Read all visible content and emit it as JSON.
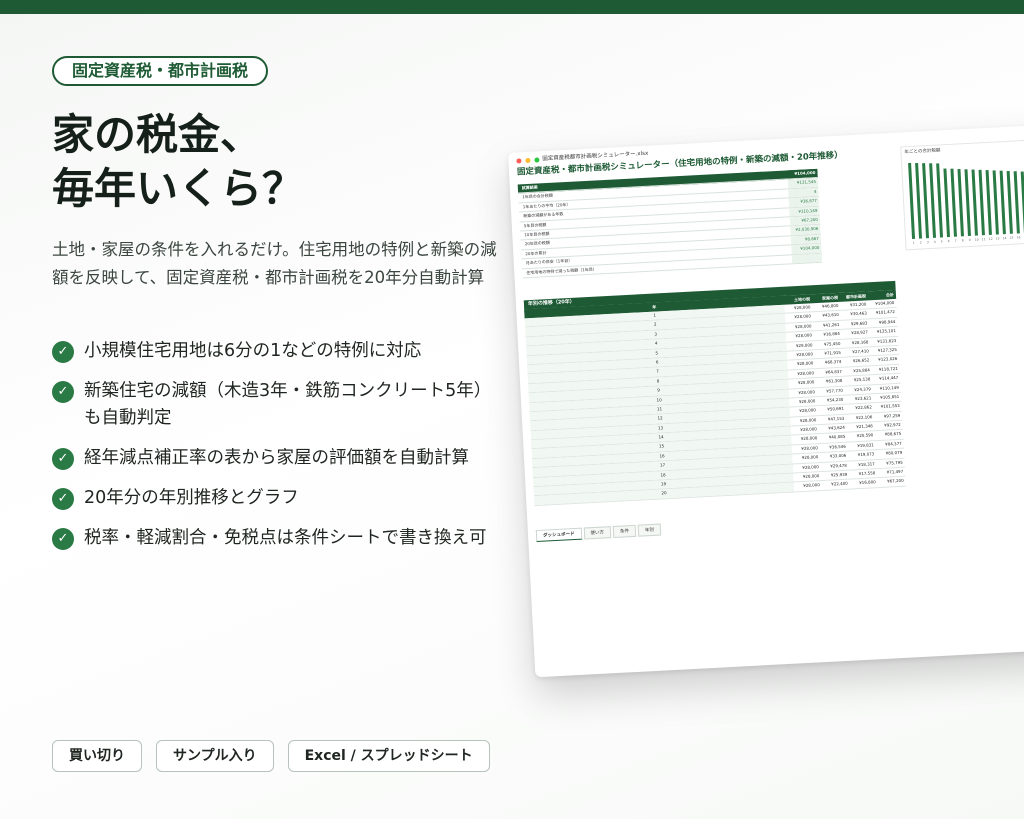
{
  "brand": {
    "primary": "#1e5b35",
    "accent": "#2a7a45"
  },
  "category": "固定資産税・都市計画税",
  "headline": {
    "line1": "家の税金、",
    "line2": "毎年いくら？"
  },
  "description": "土地・家屋の条件を入れるだけ。住宅用地の特例と新築の減額を反映して、固定資産税・都市計画税を20年分自動計算",
  "features": [
    "小規模住宅用地は6分の1などの特例に対応",
    "新築住宅の減額（木造3年・鉄筋コンクリート5年）も自動判定",
    "経年減点補正率の表から家屋の評価額を自動計算",
    "20年分の年別推移とグラフ",
    "税率・軽減割合・免税点は条件シートで書き換え可"
  ],
  "check_icon": "check-circle-icon",
  "chips": [
    "買い切り",
    "サンプル入り",
    "Excel / スプレッドシート"
  ],
  "spreadsheet": {
    "filename": "固定資産税都市計画税シミュレーター.xlsx",
    "title": "固定資産税・都市計画税シミュレーター（住宅用地の特例・新築の減額・20年推移）",
    "results_title": "試算結果",
    "results_title_value": "¥104,000",
    "results": [
      {
        "label": "1年目の合計税額",
        "value": "¥131,545"
      },
      {
        "label": "1年あたりの平均（20年）",
        "value": "4"
      },
      {
        "label": "新築の減額がある年数",
        "value": "¥36,877"
      },
      {
        "label": "5年目の税額",
        "value": "¥110,149"
      },
      {
        "label": "10年目の税額",
        "value": "¥67,200"
      },
      {
        "label": "20年目の税額",
        "value": "¥2,030,906"
      },
      {
        "label": "20年の累計",
        "value": "¥8,667"
      },
      {
        "label": "月あたりの目安（1年目）",
        "value": "¥104,000"
      },
      {
        "label": "住宅用地の特例で減った税額（1年目）",
        "value": ""
      }
    ],
    "chart_title": "年ごとの合計税額",
    "chart_values": [
      131545,
      130800,
      129900,
      129100,
      128200,
      118800,
      117800,
      116600,
      115500,
      114400,
      113300,
      112200,
      111000,
      109900,
      108800,
      107700,
      106600,
      105500,
      104400,
      104000
    ],
    "chart_ticks": [
      "1",
      "2",
      "3",
      "4",
      "5",
      "6",
      "7",
      "8",
      "9",
      "10",
      "11",
      "12",
      "13",
      "14",
      "15",
      "16",
      "17",
      "18",
      "19",
      "20"
    ],
    "annual_title": "年別の推移（20年）",
    "annual_columns": [
      "年",
      "土地の税",
      "家屋の税",
      "都市計画税",
      "合計"
    ],
    "annual_rows": [
      [
        "1",
        "¥28,000",
        "¥46,800",
        "¥31,200",
        "¥104,000"
      ],
      [
        "2",
        "¥28,000",
        "¥43,610",
        "¥30,463",
        "¥101,472"
      ],
      [
        "3",
        "¥28,000",
        "¥41,261",
        "¥29,683",
        "¥98,944"
      ],
      [
        "4",
        "¥28,000",
        "¥16,884",
        "¥28,927",
        "¥135,101"
      ],
      [
        "5",
        "¥28,000",
        "¥75,450",
        "¥28,168",
        "¥131,823"
      ],
      [
        "6",
        "¥28,000",
        "¥71,915",
        "¥27,410",
        "¥127,325"
      ],
      [
        "7",
        "¥28,000",
        "¥68,374",
        "¥26,652",
        "¥123,026"
      ],
      [
        "8",
        "¥28,000",
        "¥64,837",
        "¥25,884",
        "¥118,721"
      ],
      [
        "9",
        "¥28,000",
        "¥61,308",
        "¥25,138",
        "¥114,447"
      ],
      [
        "10",
        "¥28,000",
        "¥57,770",
        "¥24,379",
        "¥110,149"
      ],
      [
        "11",
        "¥28,000",
        "¥54,230",
        "¥23,621",
        "¥105,851"
      ],
      [
        "12",
        "¥28,000",
        "¥50,691",
        "¥22,862",
        "¥101,553"
      ],
      [
        "13",
        "¥28,000",
        "¥47,153",
        "¥22,106",
        "¥97,259"
      ],
      [
        "14",
        "¥28,000",
        "¥43,624",
        "¥21,348",
        "¥92,972"
      ],
      [
        "15",
        "¥28,000",
        "¥40,085",
        "¥20,590",
        "¥88,675"
      ],
      [
        "16",
        "¥28,000",
        "¥36,546",
        "¥19,831",
        "¥84,377"
      ],
      [
        "17",
        "¥28,000",
        "¥33,006",
        "¥19,073",
        "¥80,079"
      ],
      [
        "18",
        "¥28,000",
        "¥29,478",
        "¥18,317",
        "¥75,795"
      ],
      [
        "19",
        "¥28,000",
        "¥25,939",
        "¥17,558",
        "¥71,497"
      ],
      [
        "20",
        "¥28,000",
        "¥22,400",
        "¥16,800",
        "¥67,200"
      ]
    ],
    "tabs": [
      "ダッシュボード",
      "使い方",
      "条件",
      "年別"
    ]
  }
}
